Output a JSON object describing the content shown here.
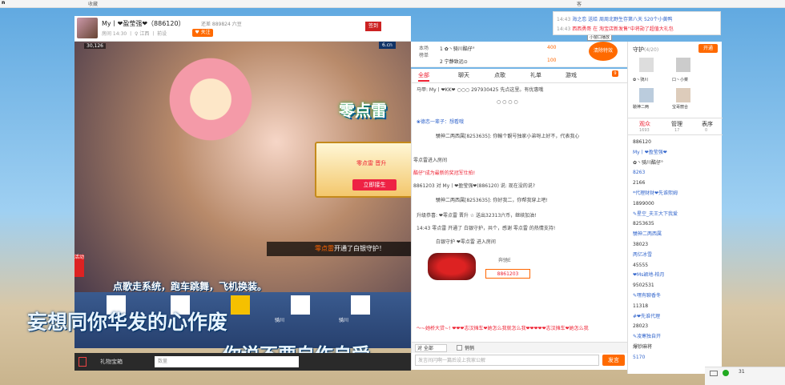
{
  "topbar": {
    "left_label": "n",
    "item1": "收藏",
    "item2": "客"
  },
  "anchor": {
    "name": "My丨❤盈莹强❤（886120）",
    "meta": "房间 14:30 丨 ♀ 江西 丨 前设",
    "follow_label": "♥ 关注",
    "fans": "还差 889824 六豆",
    "share_label": "签到"
  },
  "video": {
    "viewers": "30,126",
    "watermark": "6.cn",
    "left_badge": "活动",
    "banner": "零点雷",
    "sub_banner": "开通了白银守护！",
    "popup_title": "零点雷 晋升",
    "popup_btn": "立即接生",
    "lyric1": "点歌走系统，跑车跳舞，飞机换装。",
    "lyric2": "妄想同你华发的心作废",
    "lyric3": "你说不要自作自受",
    "anchor_names": [
      "骑川",
      "骑川"
    ]
  },
  "toolbar": {
    "gift_box": "礼物宝箱",
    "count_placeholder": "数量",
    "gift_input": ""
  },
  "rank": {
    "label1": "本场",
    "label2": "榜单",
    "rows": [
      {
        "rank": "1",
        "name": "✿丶骑川酷仔°",
        "value": "400"
      },
      {
        "rank": "2",
        "name": "宁静致远⊙",
        "value": "100"
      }
    ],
    "clear_label": "清除特效",
    "mini_window": "小窗口播放"
  },
  "notice": {
    "line1_time": "14:43",
    "line1": "海之恋 送给 周周北野生存第八天 520个小黄鸭",
    "line2_time": "14:43",
    "line2": "西西勇哥 在 淘宝店新发售\"中将勋了超值大礼包"
  },
  "chat": {
    "tabs": [
      "全部",
      "聊天",
      "点歌",
      "礼单",
      "游戏"
    ],
    "tab_badge": "9",
    "msgs": [
      {
        "text": "马甲: My丨❤KK❤ ○○○ 297930425 先点这里。有优惠哦"
      },
      {
        "text": "○ ○ ○ ○"
      },
      {
        "text": "❀德恋一辈子：想看哦"
      },
      {
        "text": "驍神二两西属[8253635]: 你輸个靚号独家小弟呀上好不，代表我心"
      },
      {
        "text": "零点雷进入房间"
      },
      {
        "text": "酷仔\"成为最新的奖冠军仕拍!"
      },
      {
        "text": "8861203 对 My丨❤盈莹强❤(886120) 说: 现在没的说?"
      },
      {
        "text": "驍神二两西属[8253635]: 你好我二，你帮我穿上吧!"
      },
      {
        "text": "升级恭喜: ❤零点雷 晋升 ☆ 送出32313六币，继续加油!"
      },
      {
        "text": "14:43 零点雷 开通了 白银守护，共个，感谢 零点雷 的热情支持!"
      },
      {
        "text": "白银守护 ❤零点雷 进入房间"
      }
    ],
    "car_name": "奔驰E",
    "car_id": "8861203",
    "marquee": "～~她桥大贷~! ❤❤❤志汉摊车❤她怎么我就怎么我❤❤❤❤❤志汉摊车❤她怎么我",
    "to_label": "对 全部",
    "private_label": "悄悄",
    "input_placeholder": "发言间闪啊一篇后设上我家公解",
    "send_label": "发言"
  },
  "guard": {
    "title": "守护",
    "count": "(4/20)",
    "open_btn": "开通",
    "members": [
      "✿丶骑川",
      "口丶小菜",
      "驍神二两",
      "宝哥丽合"
    ],
    "tabs": [
      {
        "label": "观众",
        "count": "1693"
      },
      {
        "label": "管理",
        "count": "17"
      },
      {
        "label": "表序",
        "count": "0"
      }
    ],
    "rows": [
      "886120",
      "My丨❤盈莹强❤",
      "✿丶骑川酷仔°",
      "8263",
      "2166",
      "*代理财财❤先谁熙姆",
      "1899000",
      "✎星空_夫王大下我爱",
      "8253635",
      "驍神二两西属",
      "38023",
      "两亿冰雪",
      "45555",
      "❤Ms颖地-柏月",
      "9502531",
      "✎嘿有聊香冬",
      "11318",
      "#❤先谁代理",
      "28023",
      "✎凌寒独自开",
      "爆钞麻将",
      "5170"
    ]
  },
  "status": {
    "count": "31"
  },
  "colors": {
    "accent": "#ff6a00",
    "brand_red": "#e23",
    "chat_blue": "#36c"
  }
}
